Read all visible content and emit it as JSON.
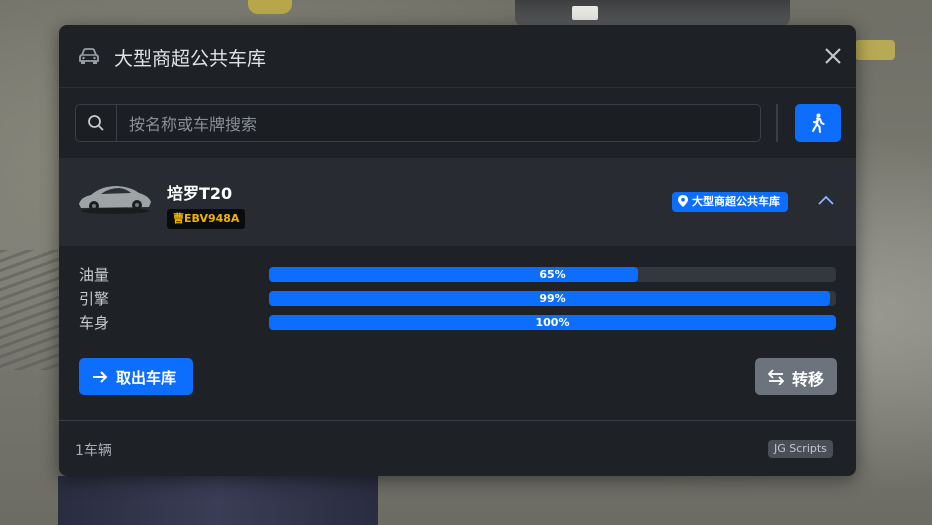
{
  "header": {
    "title": "大型商超公共车库",
    "car_icon": "car-icon",
    "close_icon": "close-icon"
  },
  "search": {
    "placeholder": "按名称或车牌搜索",
    "value": "",
    "icon": "search-icon"
  },
  "walk_button": {
    "icon": "walking-person-icon"
  },
  "vehicle": {
    "name": "培罗T20",
    "plate": "曹EBV948A",
    "location": "大型商超公共车库",
    "expanded": true
  },
  "stats": [
    {
      "label": "油量",
      "percent": 65,
      "text": "65%"
    },
    {
      "label": "引擎",
      "percent": 99,
      "text": "99%"
    },
    {
      "label": "车身",
      "percent": 100,
      "text": "100%"
    }
  ],
  "actions": {
    "take_out_label": "取出车库",
    "transfer_label": "转移"
  },
  "footer": {
    "vehicle_count": "1车辆",
    "brand": "JG Scripts"
  },
  "colors": {
    "accent": "#0d6efd",
    "panel_bg": "#1e2126",
    "row_bg": "#282c32",
    "plate_text": "#f0b400",
    "transfer_bg": "#6c737c"
  }
}
